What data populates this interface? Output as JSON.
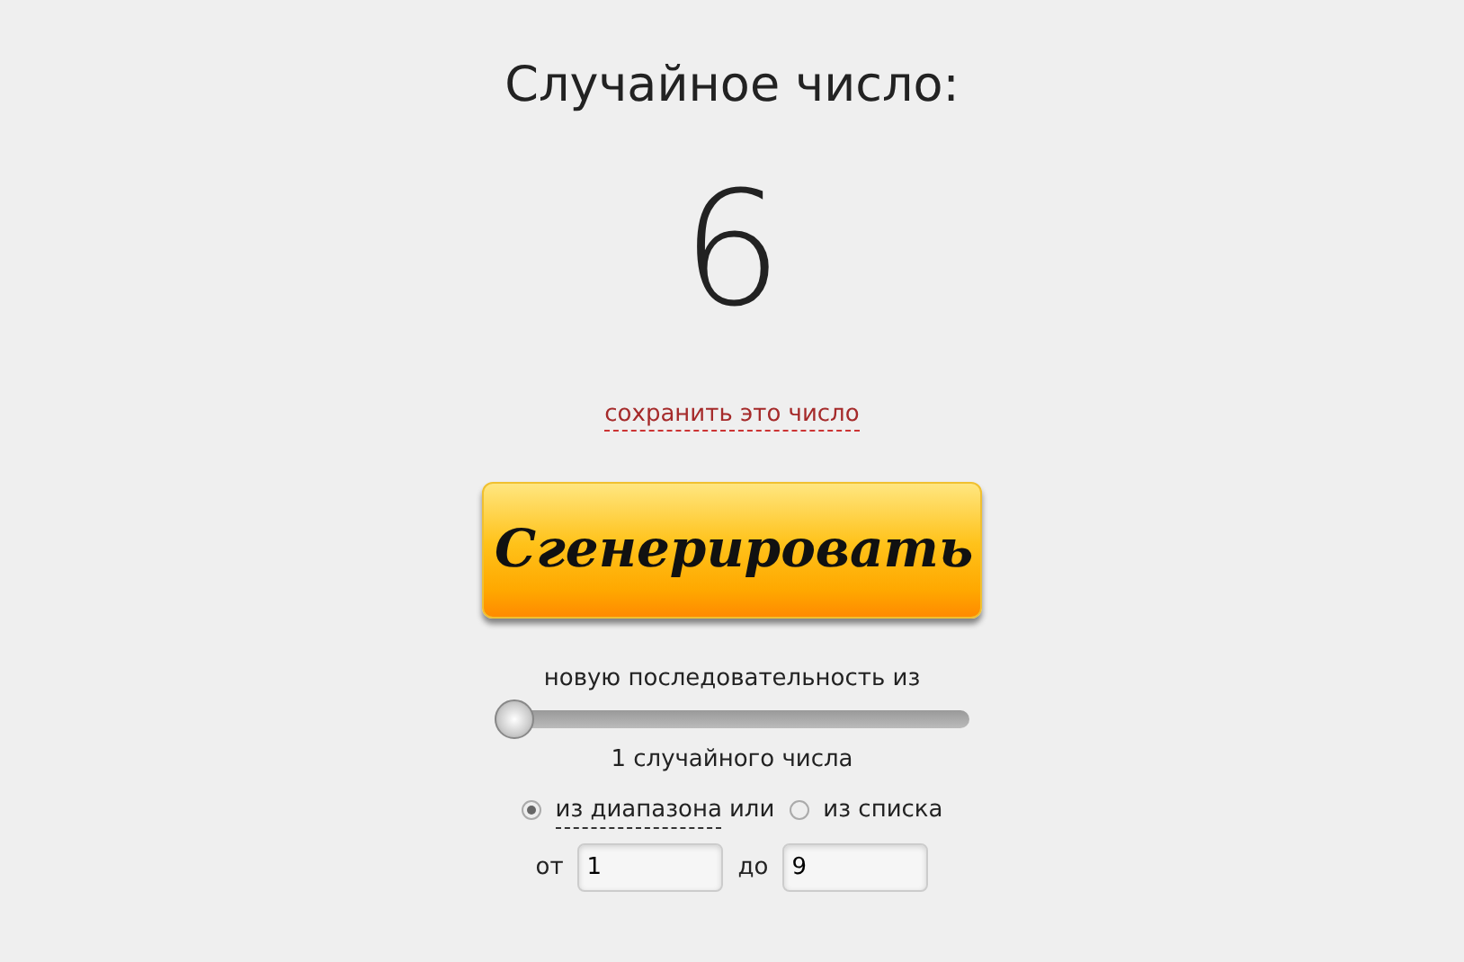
{
  "title": "Случайное число:",
  "result": "6",
  "save_link": "сохранить это число",
  "generate_button": "Сгенерировать",
  "sequence_label": "новую последовательность из",
  "count_slider": {
    "level": 0
  },
  "count_text": "1 случайного числа",
  "sources": [
    {
      "label": "из диапазона",
      "selected": true
    },
    {
      "label": "из списка",
      "selected": false
    }
  ],
  "sources_separator": "или",
  "range": {
    "from_label": "от",
    "from_value": "1",
    "to_label": "до",
    "to_value": "9"
  }
}
